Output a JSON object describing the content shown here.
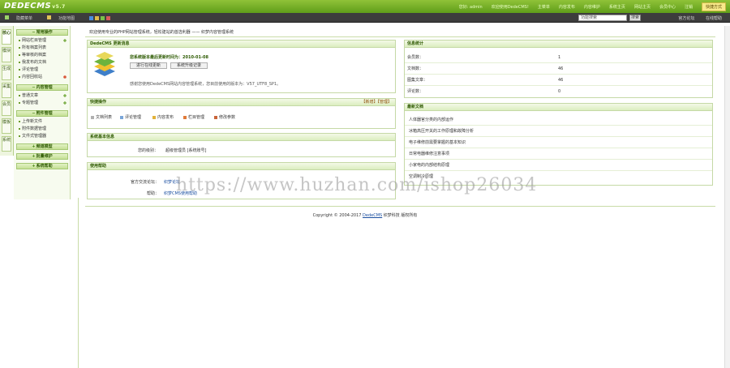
{
  "topbar": {
    "logo": "DEDECMS",
    "version": "v5.7",
    "nav": [
      "您好: admin",
      "欢迎使用DedeCMS!",
      "主菜单",
      "内容发布",
      "内容维护",
      "系统主页",
      "网站主页",
      "会员中心",
      "注销"
    ],
    "quick_menu": "快捷方式"
  },
  "toolbar": {
    "items": [
      "隐藏菜单",
      "功能地图"
    ],
    "search_placeholder": "功能搜索",
    "search_button": "搜索",
    "links": [
      "官方论坛",
      "在线帮助"
    ],
    "square_colors": [
      "#4a8de0",
      "#e0b84a",
      "#79c14a",
      "#d95a5a"
    ]
  },
  "vtabs": [
    "核心",
    "模块",
    "生成",
    "采集",
    "会员",
    "模板",
    "系统"
  ],
  "sidebar": {
    "sections": [
      {
        "label": "常用操作",
        "items": [
          {
            "label": "网站栏目管理",
            "icon": "add-icon"
          },
          {
            "label": "所有档案列表",
            "icon": null
          },
          {
            "label": "等审核的档案",
            "icon": null
          },
          {
            "label": "我发布的文档",
            "icon": null
          },
          {
            "label": "评论管理",
            "icon": null
          },
          {
            "label": "内容回收站",
            "icon": "recycle-icon"
          }
        ]
      },
      {
        "label": "内容管理",
        "items": [
          {
            "label": "普通文章",
            "icon": "add-icon"
          },
          {
            "label": "专题管理",
            "icon": "add-icon"
          }
        ]
      },
      {
        "label": "附件管理",
        "items": [
          {
            "label": "上传新文件",
            "icon": null
          },
          {
            "label": "附件数据管理",
            "icon": null
          },
          {
            "label": "文件式管理器",
            "icon": null
          }
        ]
      },
      {
        "label": "频道模型",
        "items": []
      },
      {
        "label": "批量维护",
        "items": []
      },
      {
        "label": "系统帮助",
        "items": []
      }
    ]
  },
  "welcome": "欢迎使用专业的PHP网站管理系统，轻松建站的首选利器 —— 织梦内容管理系统",
  "update_panel": {
    "title": "DedeCMS 更新消息",
    "update_line": "您系统版本最后更新时间为：2010-01-08",
    "btn_check": "进行在线更新",
    "btn_log": "系统升级记录",
    "thanks": "感谢您使用DedeCMS网站内容管理系统，您目前使用的版本为：V57_UTF8_SP1。"
  },
  "quick_panel": {
    "title": "快捷操作",
    "links": "【新增】【管理】",
    "items": [
      "文档列表",
      "评论管理",
      "内容发布",
      "栏目管理",
      "修改参数"
    ]
  },
  "sysinfo_panel": {
    "title": "系统基本信息",
    "label": "您的级别：",
    "value": "超级管理员 [系统账号]"
  },
  "dev_panel": {
    "title": "使用帮助",
    "rows": [
      {
        "label": "官方交流论坛：",
        "value": "织梦论坛"
      },
      {
        "label": "帮助：",
        "value": "织梦CMS使用帮助"
      }
    ]
  },
  "stats_panel": {
    "title": "信息统计",
    "rows": [
      {
        "label": "会员数：",
        "value": "1"
      },
      {
        "label": "文档数：",
        "value": "46"
      },
      {
        "label": "图集文章：",
        "value": "46"
      },
      {
        "label": "评论数：",
        "value": "0"
      }
    ]
  },
  "articles_panel": {
    "title": "最新文档",
    "items": [
      "人体器官分类的内部运作",
      "冰箱高压开关的工作原理和故障分析",
      "电子维修前需要掌握的基本知识",
      "日常电器维修注意事项",
      "小家电的内部结构原理",
      "空调制冷原理"
    ]
  },
  "copyright": {
    "prefix": "Copyright © 2004-2017 ",
    "link": "DedeCMS",
    "suffix": " 织梦科技 版权所有"
  },
  "watermark": "https://www.huzhan.com/ishop26034"
}
